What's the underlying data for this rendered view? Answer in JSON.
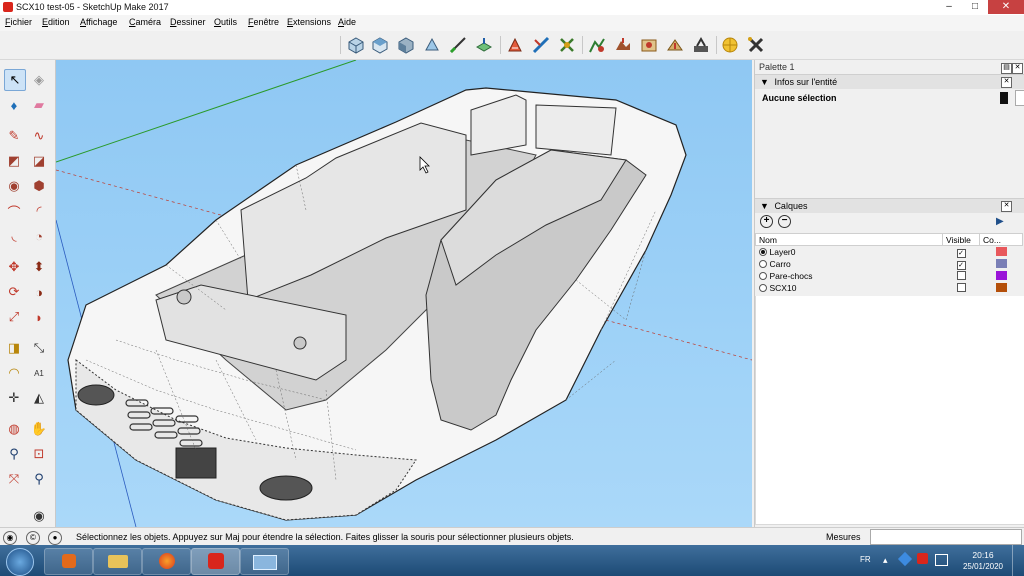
{
  "window": {
    "title": "SCX10 test-05 - SketchUp Make 2017",
    "controls": {
      "minimize": "–",
      "maximize": "□",
      "close": "✕"
    }
  },
  "menu": [
    {
      "label": "Fichier",
      "mnemonic": "F",
      "rest": "ichier"
    },
    {
      "label": "Edition",
      "mnemonic": "E",
      "rest": "dition"
    },
    {
      "label": "Affichage",
      "mnemonic": "A",
      "rest": "ffichage"
    },
    {
      "label": "Caméra",
      "mnemonic": "C",
      "rest": "améra"
    },
    {
      "label": "Dessiner",
      "mnemonic": "D",
      "rest": "essiner"
    },
    {
      "label": "Outils",
      "mnemonic": "O",
      "rest": "utils"
    },
    {
      "label": "Fenêtre",
      "mnemonic": "F",
      "rest": "enêtre"
    },
    {
      "label": "Extensions",
      "mnemonic": "E",
      "rest": "xtensions"
    },
    {
      "label": "Aide",
      "mnemonic": "A",
      "rest": "ide"
    }
  ],
  "toolbar_icons": [
    "iso-view-icon",
    "top-view-icon",
    "front-view-icon",
    "right-view-icon",
    "back-view-icon",
    "left-view-icon",
    "section-plane-icon",
    "section-cut-icon",
    "section-fill-icon",
    "add-location-icon",
    "toggle-terrain-icon",
    "photo-texture-icon",
    "share-model-icon",
    "warehouse-icon",
    "extension-warehouse-icon",
    "send-layout-icon",
    "geo-icon",
    "extension-manager-icon"
  ],
  "tools_palette": {
    "title": "Palette 1",
    "entity_info": {
      "header": "Infos sur l'entité",
      "value": "Aucune sélection"
    },
    "layers": {
      "header": "Calques",
      "columns": {
        "name": "Nom",
        "visible": "Visible",
        "color": "Co..."
      },
      "rows": [
        {
          "name": "Layer0",
          "active": true,
          "visible": true,
          "color": "#e8585c"
        },
        {
          "name": "Carro",
          "active": false,
          "visible": true,
          "color": "#7a7fb6"
        },
        {
          "name": "Pare-chocs",
          "active": false,
          "visible": false,
          "color": "#9a14d8"
        },
        {
          "name": "SCX10",
          "active": false,
          "visible": false,
          "color": "#b44f0a"
        }
      ]
    }
  },
  "status": {
    "message": "Sélectionnez les objets. Appuyez sur Maj pour étendre la sélection. Faites glisser la souris pour sélectionner plusieurs objets.",
    "measures_label": "Mesures",
    "measures_value": ""
  },
  "taskbar": {
    "apps": [
      "windows-start-icon",
      "media-player-icon",
      "file-explorer-icon",
      "firefox-icon",
      "sketchup-icon",
      "window-preview-icon"
    ],
    "language": "FR",
    "time": "20:16",
    "date": "25/01/2020"
  }
}
